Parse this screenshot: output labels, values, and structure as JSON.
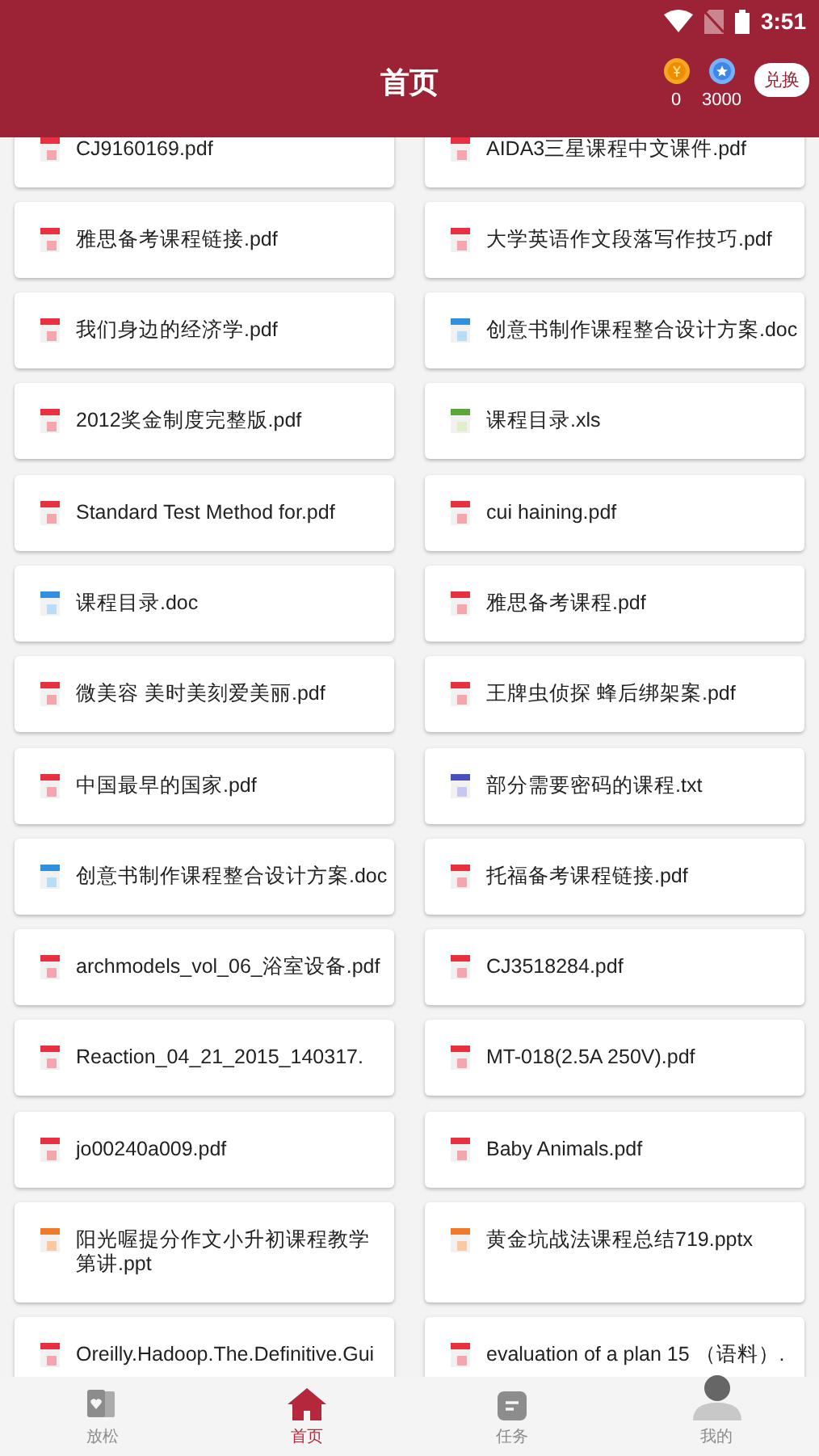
{
  "status_bar": {
    "time": "3:51"
  },
  "header": {
    "title": "首页",
    "wallet": [
      {
        "kind": "coin",
        "amount": "0"
      },
      {
        "kind": "star",
        "amount": "3000"
      }
    ],
    "exchange_button": "兑换"
  },
  "files": [
    {
      "name": "CJ9160169.pdf",
      "kind": "pdf"
    },
    {
      "name": "AIDA3三星课程中文课件.pdf",
      "kind": "pdf"
    },
    {
      "name": "雅思备考课程链接.pdf",
      "kind": "pdf"
    },
    {
      "name": "大学英语作文段落写作技巧.pdf",
      "kind": "pdf"
    },
    {
      "name": "我们身边的经济学.pdf",
      "kind": "pdf"
    },
    {
      "name": "创意书制作课程整合设计方案.doc",
      "kind": "doc"
    },
    {
      "name": "2012奖金制度完整版.pdf",
      "kind": "pdf"
    },
    {
      "name": "课程目录.xls",
      "kind": "xls"
    },
    {
      "name": "Standard Test Method for.pdf",
      "kind": "pdf"
    },
    {
      "name": "cui haining.pdf",
      "kind": "pdf"
    },
    {
      "name": "课程目录.doc",
      "kind": "doc"
    },
    {
      "name": "雅思备考课程.pdf",
      "kind": "pdf"
    },
    {
      "name": "微美容 美时美刻爱美丽.pdf",
      "kind": "pdf"
    },
    {
      "name": "王牌虫侦探 蜂后绑架案.pdf",
      "kind": "pdf"
    },
    {
      "name": "中国最早的国家.pdf",
      "kind": "pdf"
    },
    {
      "name": "部分需要密码的课程.txt",
      "kind": "txt"
    },
    {
      "name": "创意书制作课程整合设计方案.doc",
      "kind": "doc"
    },
    {
      "name": "托福备考课程链接.pdf",
      "kind": "pdf"
    },
    {
      "name": "archmodels_vol_06_浴室设备.pdf",
      "kind": "pdf"
    },
    {
      "name": "CJ3518284.pdf",
      "kind": "pdf"
    },
    {
      "name": "Reaction_04_21_2015_140317.",
      "kind": "pdf"
    },
    {
      "name": "MT-018(2.5A 250V).pdf",
      "kind": "pdf"
    },
    {
      "name": "jo00240a009.pdf",
      "kind": "pdf"
    },
    {
      "name": "Baby Animals.pdf",
      "kind": "pdf"
    },
    {
      "name": "阳光喔提分作文小升初课程教学第讲.ppt",
      "kind": "ppt"
    },
    {
      "name": "黄金坑战法课程总结719.pptx",
      "kind": "ppt"
    },
    {
      "name": "Oreilly.Hadoop.The.Definitive.Gui",
      "kind": "pdf"
    },
    {
      "name": "evaluation of a plan 15 （语料）.",
      "kind": "pdf"
    }
  ],
  "bottom_nav": [
    {
      "label": "放松",
      "selected": false
    },
    {
      "label": "首页",
      "selected": true
    },
    {
      "label": "任务",
      "selected": false
    },
    {
      "label": "我的",
      "selected": false
    }
  ]
}
